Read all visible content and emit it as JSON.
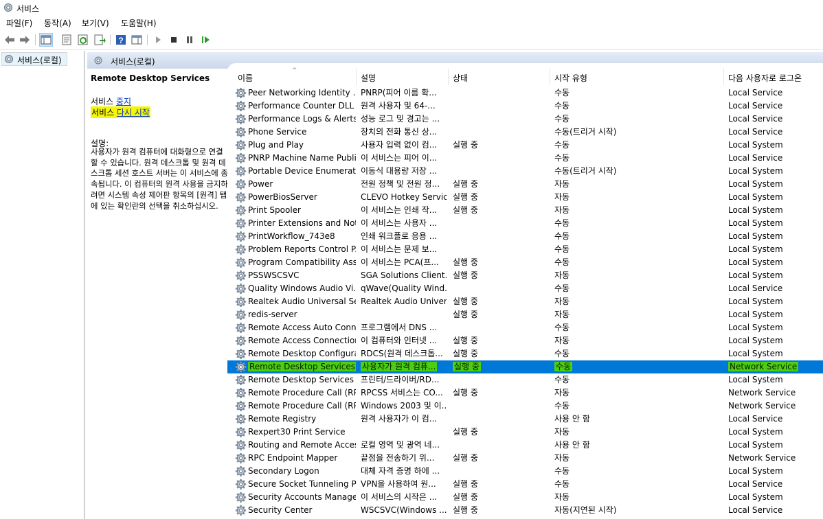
{
  "window": {
    "title": "서비스"
  },
  "menu": [
    "파일(F)",
    "동작(A)",
    "보기(V)",
    "도움말(H)"
  ],
  "toolbar_icons": [
    "back-arrow-icon",
    "forward-arrow-icon",
    "console-tree-icon",
    "properties-icon",
    "refresh-icon",
    "export-list-icon",
    "help-icon",
    "show-hide-action-icon",
    "play-icon",
    "stop-icon",
    "pause-icon",
    "restart-icon"
  ],
  "tree": {
    "root": "서비스(로컬)"
  },
  "main_header": "서비스(로컬)",
  "desc_panel": {
    "title": "Remote Desktop Services",
    "stop_prefix": "서비스 ",
    "stop_link": "중지",
    "restart_prefix": "서비스 ",
    "restart_link": "다시 시작",
    "desc_label": "설명:",
    "desc_text": "사용자가 원격 컴퓨터에 대화형으로 연결할 수 있습니다. 원격 데스크톱 및 원격 데스크톱 세션 호스트 서버는 이 서비스에 종속됩니다. 이 컴퓨터의 원격 사용을 금지하려면 시스템 속성 제어판 항목의 [원격] 탭에 있는 확인란의 선택을 취소하십시오."
  },
  "columns": [
    "이름",
    "설명",
    "상태",
    "시작 유형",
    "다음 사용자로 로그온"
  ],
  "colors": {
    "selection": "#0078d7",
    "highlight_yellow": "#f5f50a",
    "highlight_green": "#4bd011",
    "link": "#0033cc"
  },
  "services": [
    {
      "name": "Peer Networking Identity ...",
      "desc": "PNRP(피어 이름 확...",
      "status": "",
      "start": "수동",
      "logon": "Local Service"
    },
    {
      "name": "Performance Counter DLL ...",
      "desc": "원격 사용자 및 64-...",
      "status": "",
      "start": "수동",
      "logon": "Local Service"
    },
    {
      "name": "Performance Logs & Alerts",
      "desc": "성능 로그 및 경고는 ...",
      "status": "",
      "start": "수동",
      "logon": "Local Service"
    },
    {
      "name": "Phone Service",
      "desc": "장치의 전화 통신 상...",
      "status": "",
      "start": "수동(트리거 시작)",
      "logon": "Local Service"
    },
    {
      "name": "Plug and Play",
      "desc": "사용자 입력 없이 컴...",
      "status": "실행 중",
      "start": "수동",
      "logon": "Local System"
    },
    {
      "name": "PNRP Machine Name Publi...",
      "desc": "이 서비스는 피어 이...",
      "status": "",
      "start": "수동",
      "logon": "Local Service"
    },
    {
      "name": "Portable Device Enumerato...",
      "desc": "이동식 대용량 저장 ...",
      "status": "",
      "start": "수동(트리거 시작)",
      "logon": "Local System"
    },
    {
      "name": "Power",
      "desc": "전원 정책 및 전원 정...",
      "status": "실행 중",
      "start": "자동",
      "logon": "Local System"
    },
    {
      "name": "PowerBiosServer",
      "desc": "CLEVO Hotkey Service",
      "status": "실행 중",
      "start": "자동",
      "logon": "Local System"
    },
    {
      "name": "Print Spooler",
      "desc": "이 서비스는 인쇄 작...",
      "status": "실행 중",
      "start": "자동",
      "logon": "Local System"
    },
    {
      "name": "Printer Extensions and Noti...",
      "desc": "이 서비스는 사용자 ...",
      "status": "",
      "start": "수동",
      "logon": "Local System"
    },
    {
      "name": "PrintWorkflow_743e8",
      "desc": "인쇄 워크플로 응용 ...",
      "status": "",
      "start": "수동",
      "logon": "Local System"
    },
    {
      "name": "Problem Reports Control P...",
      "desc": "이 서비스는 문제 보...",
      "status": "",
      "start": "수동",
      "logon": "Local System"
    },
    {
      "name": "Program Compatibility Assi...",
      "desc": "이 서비스는 PCA(프...",
      "status": "실행 중",
      "start": "수동",
      "logon": "Local System"
    },
    {
      "name": "PSSWSCSVC",
      "desc": "SGA Solutions Client...",
      "status": "실행 중",
      "start": "자동",
      "logon": "Local System"
    },
    {
      "name": "Quality Windows Audio Vi...",
      "desc": "qWave(Quality Wind...",
      "status": "",
      "start": "수동",
      "logon": "Local Service"
    },
    {
      "name": "Realtek Audio Universal Ser...",
      "desc": "Realtek Audio Univer...",
      "status": "실행 중",
      "start": "자동",
      "logon": "Local System"
    },
    {
      "name": "redis-server",
      "desc": "",
      "status": "실행 중",
      "start": "자동",
      "logon": "Local System"
    },
    {
      "name": "Remote Access Auto Conn...",
      "desc": "프로그램에서 DNS ...",
      "status": "",
      "start": "수동",
      "logon": "Local System"
    },
    {
      "name": "Remote Access Connection...",
      "desc": "이 컴퓨터와 인터넷 ...",
      "status": "실행 중",
      "start": "자동",
      "logon": "Local System"
    },
    {
      "name": "Remote Desktop Configura...",
      "desc": "RDCS(원격 데스크톱...",
      "status": "실행 중",
      "start": "수동",
      "logon": "Local System"
    },
    {
      "name": "Remote Desktop Services",
      "desc": "사용자가 원격 컴퓨...",
      "status": "실행 중",
      "start": "수동",
      "logon": "Network Service",
      "selected": true
    },
    {
      "name": "Remote Desktop Services ...",
      "desc": "프린터/드라이버/RD...",
      "status": "",
      "start": "수동",
      "logon": "Local System"
    },
    {
      "name": "Remote Procedure Call (RP...",
      "desc": "RPCSS 서비스는 CO...",
      "status": "실행 중",
      "start": "자동",
      "logon": "Network Service"
    },
    {
      "name": "Remote Procedure Call (RP...",
      "desc": "Windows 2003 및 이...",
      "status": "",
      "start": "수동",
      "logon": "Network Service"
    },
    {
      "name": "Remote Registry",
      "desc": "원격 사용자가 이 컴...",
      "status": "",
      "start": "사용 안 함",
      "logon": "Local Service"
    },
    {
      "name": "Rexpert30 Print Service",
      "desc": "",
      "status": "실행 중",
      "start": "자동",
      "logon": "Local System"
    },
    {
      "name": "Routing and Remote Access",
      "desc": "로컬 영역 및 광역 네...",
      "status": "",
      "start": "사용 안 함",
      "logon": "Local System"
    },
    {
      "name": "RPC Endpoint Mapper",
      "desc": "끝점을 전송하기 위...",
      "status": "실행 중",
      "start": "자동",
      "logon": "Network Service"
    },
    {
      "name": "Secondary Logon",
      "desc": "대체 자격 증명 하에 ...",
      "status": "",
      "start": "수동",
      "logon": "Local System"
    },
    {
      "name": "Secure Socket Tunneling P...",
      "desc": "VPN을 사용하여 원...",
      "status": "실행 중",
      "start": "수동",
      "logon": "Local Service"
    },
    {
      "name": "Security Accounts Manager",
      "desc": "이 서비스의 시작은 ...",
      "status": "실행 중",
      "start": "자동",
      "logon": "Local System"
    },
    {
      "name": "Security Center",
      "desc": "WSCSVC(Windows ...",
      "status": "실행 중",
      "start": "자동(지연된 시작)",
      "logon": "Local Service"
    }
  ]
}
